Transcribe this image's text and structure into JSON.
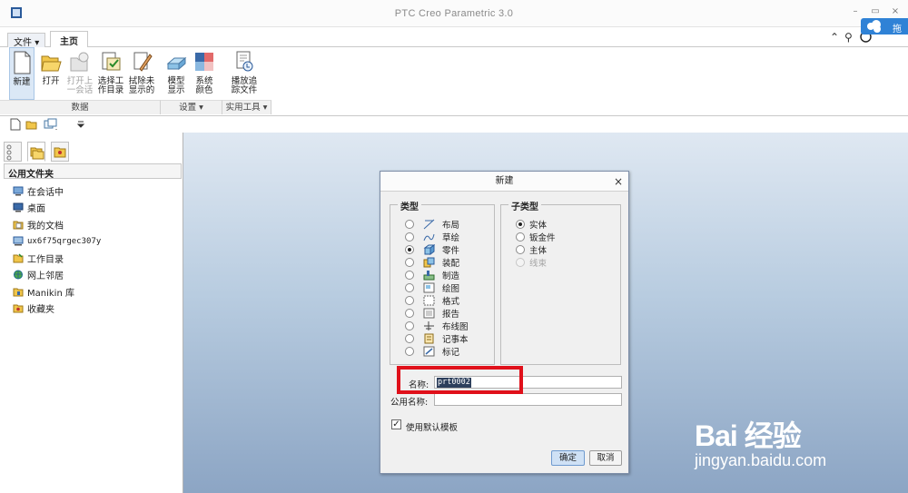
{
  "window": {
    "title": "PTC Creo Parametric 3.0",
    "controls": [
      "–",
      "▭",
      "×"
    ]
  },
  "ribbon": {
    "tabs": [
      {
        "label": "文件",
        "has_dropdown": true
      },
      {
        "label": "主页",
        "active": true
      }
    ],
    "corner_badge": "拖拽",
    "buttons": [
      {
        "line1": "新建",
        "line2": "",
        "icon": "new-file-icon",
        "selected": true
      },
      {
        "line1": "打开",
        "line2": "",
        "icon": "open-folder-icon"
      },
      {
        "line1": "打开上",
        "line2": "一会话",
        "icon": "open-last-session-icon",
        "disabled": true
      },
      {
        "line1": "选择工",
        "line2": "作目录",
        "icon": "working-directory-icon"
      },
      {
        "line1": "拭除未",
        "line2": "显示的",
        "icon": "erase-not-displayed-icon"
      },
      {
        "line1": "模型",
        "line2": "显示",
        "icon": "model-display-icon"
      },
      {
        "line1": "系统",
        "line2": "颜色",
        "icon": "system-colors-icon"
      },
      {
        "line1": "播放追",
        "line2": "踪文件",
        "icon": "play-trail-file-icon"
      }
    ],
    "groups": [
      {
        "label": "数据"
      },
      {
        "label": "设置 ▾"
      },
      {
        "label": "实用工具 ▾"
      }
    ]
  },
  "navigator": {
    "header": "公用文件夹",
    "items": [
      {
        "label": "在会话中",
        "icon": "in-session-icon"
      },
      {
        "label": "桌面",
        "icon": "desktop-icon"
      },
      {
        "label": "我的文档",
        "icon": "my-documents-icon"
      },
      {
        "label": "ux6f75qrgec307y",
        "icon": "computer-icon",
        "mono": true
      },
      {
        "label": "工作目录",
        "icon": "working-directory-folder-icon"
      },
      {
        "label": "网上邻居",
        "icon": "network-icon"
      },
      {
        "label": "Manikin 库",
        "icon": "manikin-library-icon"
      },
      {
        "label": "收藏夹",
        "icon": "favorites-icon"
      }
    ]
  },
  "dialog": {
    "title": "新建",
    "type_legend": "类型",
    "subtype_legend": "子类型",
    "types": [
      {
        "label": "布局",
        "icon": "layout-icon",
        "selected": false
      },
      {
        "label": "草绘",
        "icon": "sketch-icon",
        "selected": false
      },
      {
        "label": "零件",
        "icon": "part-icon",
        "selected": true
      },
      {
        "label": "装配",
        "icon": "assembly-icon",
        "selected": false
      },
      {
        "label": "制造",
        "icon": "manufacturing-icon",
        "selected": false
      },
      {
        "label": "绘图",
        "icon": "drawing-icon",
        "selected": false
      },
      {
        "label": "格式",
        "icon": "format-icon",
        "selected": false
      },
      {
        "label": "报告",
        "icon": "report-icon",
        "selected": false
      },
      {
        "label": "布线图",
        "icon": "diagram-icon",
        "selected": false
      },
      {
        "label": "记事本",
        "icon": "notebook-icon",
        "selected": false
      },
      {
        "label": "标记",
        "icon": "markup-icon",
        "selected": false
      }
    ],
    "subtypes": [
      {
        "label": "实体",
        "selected": true,
        "disabled": false
      },
      {
        "label": "钣金件",
        "selected": false,
        "disabled": false
      },
      {
        "label": "主体",
        "selected": false,
        "disabled": false
      },
      {
        "label": "线束",
        "selected": false,
        "disabled": true
      }
    ],
    "name_label": "名称:",
    "name_value": "prt0002",
    "common_name_label": "公用名称:",
    "common_name_value": "",
    "use_default_template_label": "使用默认模板",
    "use_default_template_checked": true,
    "ok_label": "确定",
    "cancel_label": "取消",
    "close_symbol": "×"
  },
  "watermark": {
    "main": "Bai 经验",
    "sub": "jingyan.baidu.com"
  },
  "colors": {
    "accent_blue": "#2f82d6",
    "highlight_red": "#e0101a",
    "selection_bg": "#2d3f5c"
  }
}
